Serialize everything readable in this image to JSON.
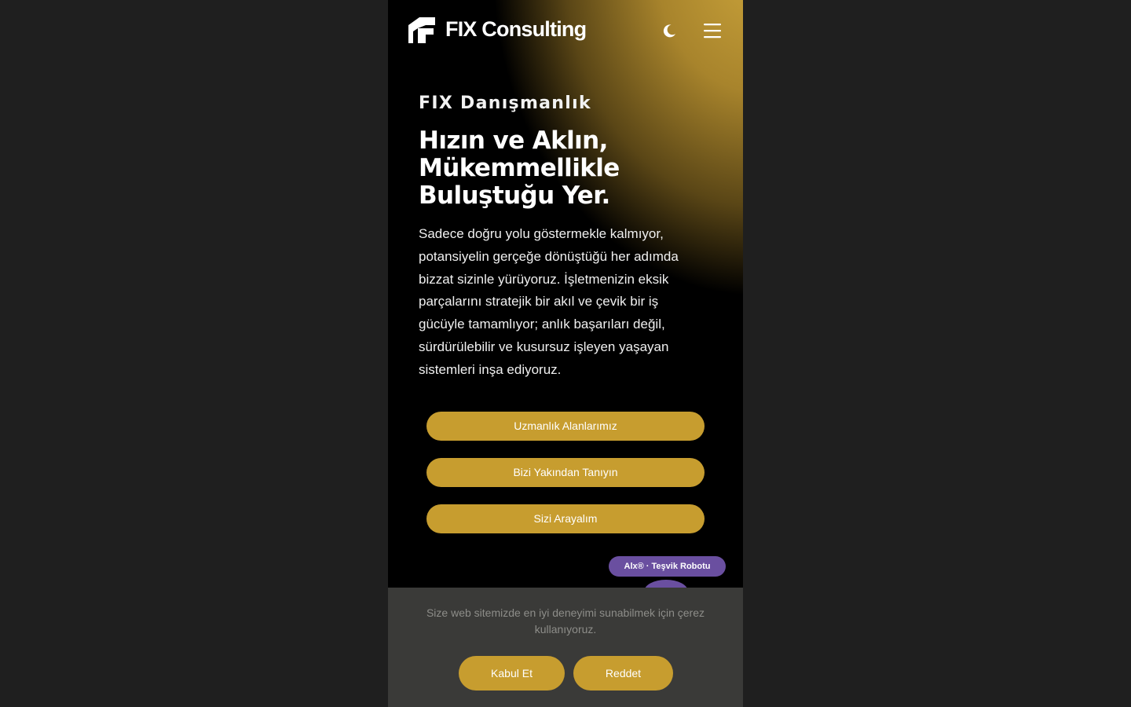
{
  "header": {
    "brand": "FIX Consulting",
    "logo_icon": "fix-logo-icon",
    "theme_toggle_icon": "moon-icon",
    "menu_icon": "hamburger-menu-icon"
  },
  "hero": {
    "eyebrow": "FIX Danışmanlık",
    "headline_lines": [
      "Hızın ve Aklın,",
      "Mükemmellikle",
      "Buluştuğu Yer."
    ],
    "body_lines": [
      "Sadece doğru yolu göstermekle kalmıyor,",
      "potansiyelin gerçeğe dönüştüğü her adımda",
      "bizzat sizinle yürüyoruz. İşletmenizin eksik",
      "parçalarını stratejik bir akıl ve çevik bir iş",
      "gücüyle tamamlıyor; anlık başarıları değil,",
      "sürdürülebilir ve kusursuz işleyen yaşayan",
      "sistemleri inşa ediyoruz."
    ],
    "buttons": [
      "Uzmanlık Alanlarımız",
      "Bizi Yakından Tanıyın",
      "Sizi Arayalım"
    ]
  },
  "chatbot": {
    "label": "Alx® · Teşvik Robotu"
  },
  "cookie_banner": {
    "message_lines": [
      "Size web sitemizde en iyi deneyimi sunabilmek için çerez",
      "kullanıyoruz."
    ],
    "accept_label": "Kabul Et",
    "reject_label": "Reddet"
  },
  "colors": {
    "accent": "#c79d2f",
    "background": "#000000",
    "outer_background": "#1f1f1f",
    "cookie_background": "#3a3a38",
    "chatbot": "#6a4fa0"
  }
}
